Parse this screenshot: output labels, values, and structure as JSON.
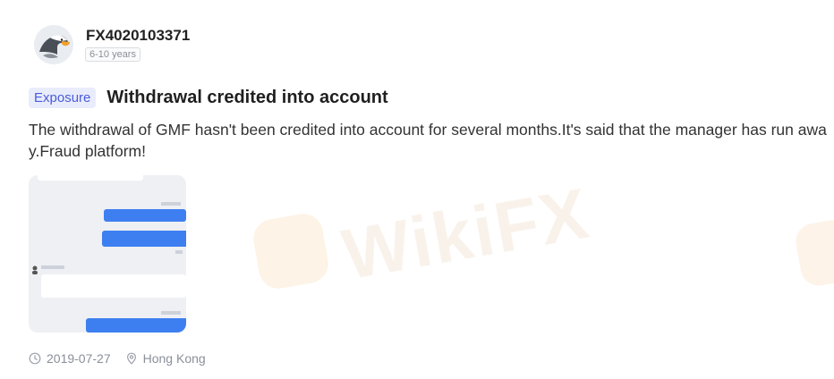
{
  "user": {
    "name": "FX4020103371",
    "tenure": "6-10 years",
    "avatar_icon": "eagle-avatar-icon"
  },
  "post": {
    "tag": "Exposure",
    "title": "Withdrawal credited into account",
    "body": "The withdrawal of GMF hasn't been credited into account for several months.It's said that the manager has run away.Fraud platform!",
    "date": "2019-07-27",
    "location": "Hong Kong"
  },
  "watermark": {
    "text": "WikiFX"
  },
  "colors": {
    "tag_text": "#4a5cd9",
    "tag_bg": "#e9ecfb",
    "chat_outgoing": "#3d7ff0",
    "watermark": "#f3a54a"
  }
}
